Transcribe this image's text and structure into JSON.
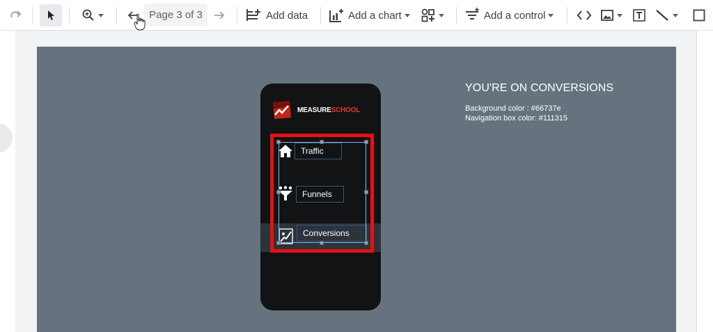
{
  "toolbar": {
    "page_indicator": "Page 3 of 3",
    "add_data_label": "Add data",
    "add_chart_label": "Add a chart",
    "add_control_label": "Add a control"
  },
  "report": {
    "brand": {
      "part1": "MEASURE",
      "part2": "SCHOOL"
    },
    "nav": [
      {
        "label": "Traffic"
      },
      {
        "label": "Funnels"
      },
      {
        "label": "Conversions"
      }
    ],
    "heading": "YOU'RE ON CONVERSIONS",
    "background_color_text": "Background color : #66737e",
    "nav_box_color_text": "Navigation box color: #111315"
  },
  "colors": {
    "canvas_bg": "#66737e",
    "nav_box": "#111315",
    "highlight": "#e81010",
    "brand_red": "#e03a2b"
  }
}
